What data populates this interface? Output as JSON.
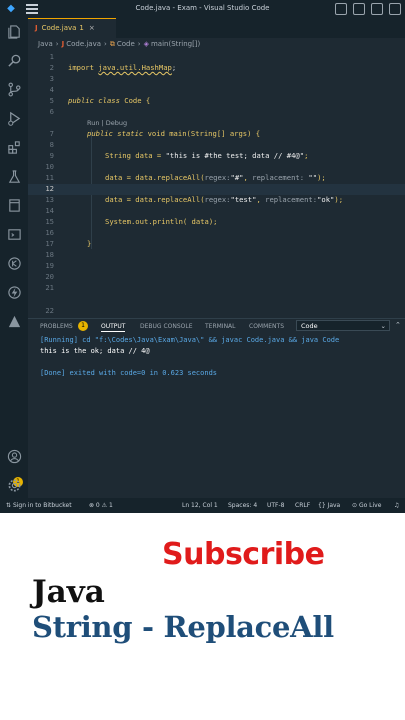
{
  "window": {
    "title": "Code.java - Exam - Visual Studio Code"
  },
  "tab": {
    "label": "Code.java",
    "badge": "1",
    "close": "×"
  },
  "breadcrumb": {
    "folder": "Java",
    "file": "Code.java",
    "class": "Code",
    "method": "main(String[])"
  },
  "editor": {
    "codelens": "Run | Debug",
    "lines": [
      {
        "n": "1"
      },
      {
        "n": "2"
      },
      {
        "n": "3"
      },
      {
        "n": "4"
      },
      {
        "n": "5"
      },
      {
        "n": "6"
      },
      {
        "n": "7"
      },
      {
        "n": "8"
      },
      {
        "n": "9"
      },
      {
        "n": "10"
      },
      {
        "n": "11"
      },
      {
        "n": "12"
      },
      {
        "n": "13"
      },
      {
        "n": "14"
      },
      {
        "n": "15"
      },
      {
        "n": "16"
      },
      {
        "n": "17"
      },
      {
        "n": "18"
      },
      {
        "n": "19"
      },
      {
        "n": "20"
      },
      {
        "n": "21"
      },
      {
        "n": "22"
      }
    ],
    "code": {
      "l2_kw": "import",
      "l2_pkg": "java.util.HashMap",
      "l2_end": ";",
      "l5_kw1": "public",
      "l5_kw2": "class",
      "l5_name": "Code",
      "l5_brace": "{",
      "l7_kw1": "public",
      "l7_kw2": "static",
      "l7_type": "void",
      "l7_sig": "main(String[] args)",
      "l7_brace": "{",
      "l9_a": "String data = ",
      "l9_str": "\"this is #the test; data // #4@\"",
      "l9_end": ";",
      "l11_a": "data = data.replaceAll(",
      "l11_h1": "regex:",
      "l11_s1": "\"#\"",
      "l11_h2": "replacement:",
      "l11_s2": "\"\"",
      "l11_end": ");",
      "l13_a": "data = data.replaceAll(",
      "l13_h1": "regex:",
      "l13_s1": "\"test\"",
      "l13_h2": "replacement:",
      "l13_s2": "\"ok\"",
      "l13_end": ");",
      "l15_a": "System.out.println( data);",
      "l17_brace": "}"
    }
  },
  "panel": {
    "tabs": {
      "problems": "PROBLEMS",
      "problems_badge": "1",
      "output": "OUTPUT",
      "debug": "DEBUG CONSOLE",
      "terminal": "TERMINAL",
      "comments": "COMMENTS"
    },
    "select": "Code",
    "output": {
      "running": "[Running] cd \"f:\\Codes\\Java\\Exam\\Java\\\" && javac Code.java && java Code",
      "result": "this is the ok; data // 4@",
      "done": "[Done] exited with code=0 in 0.623 seconds"
    }
  },
  "statusbar": {
    "bitbucket": "Sign in to Bitbucket",
    "problems": "⊗ 0 ⚠ 1",
    "position": "Ln 12, Col 1",
    "spaces": "Spaces: 4",
    "encoding": "UTF-8",
    "eol": "CRLF",
    "language": "Java",
    "golive": "Go Live"
  },
  "activity": {
    "account_badge": "1"
  },
  "caption": {
    "subscribe": "Subscribe",
    "language": "Java",
    "topic": "String - ReplaceAll"
  },
  "colors": {
    "editor_bg": "#1e2a33",
    "keyword": "#e8c866",
    "subscribe": "#e01b1b",
    "topic": "#1f4e79"
  }
}
